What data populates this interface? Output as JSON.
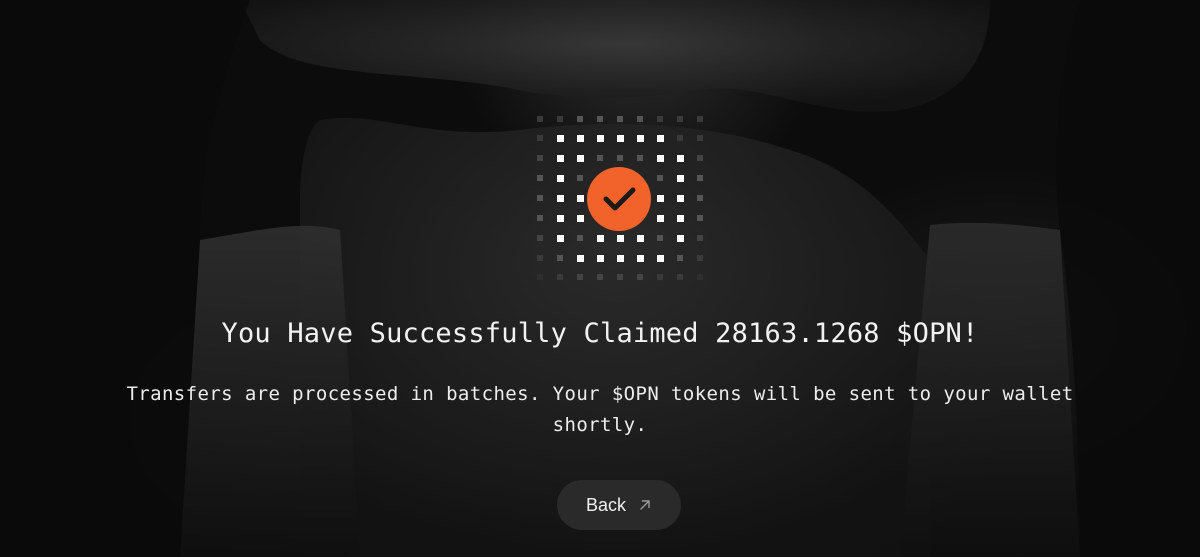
{
  "success": {
    "title": "You Have Successfully Claimed 28163.1268 $OPN!",
    "message": "Transfers are processed in batches. Your $OPN tokens will be sent to your wallet shortly.",
    "icon": "check-icon",
    "accent_color": "#f2622b"
  },
  "actions": {
    "back_label": "Back",
    "back_icon": "arrow-up-right-icon"
  }
}
